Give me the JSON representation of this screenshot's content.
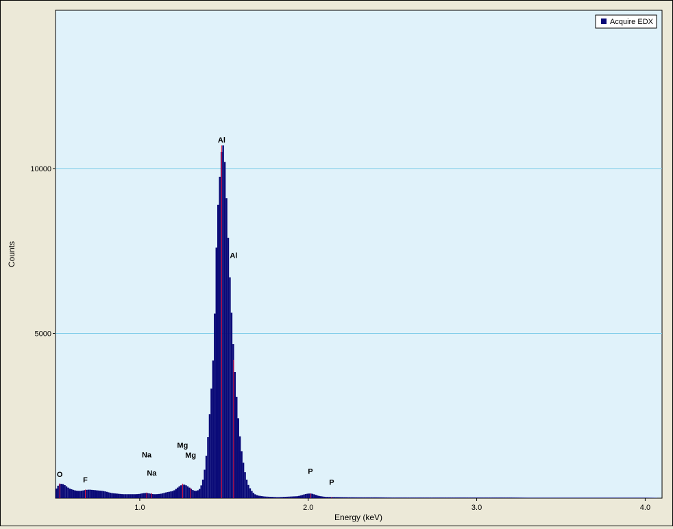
{
  "chart_data": {
    "type": "bar",
    "xlabel": "Energy (keV)",
    "ylabel": "Counts",
    "xlim": [
      0.5,
      4.1
    ],
    "ylim": [
      0,
      14800
    ],
    "x_ticks": [
      {
        "value": 1.0,
        "label": "1.0"
      },
      {
        "value": 2.0,
        "label": "2.0"
      },
      {
        "value": 3.0,
        "label": "3.0"
      },
      {
        "value": 4.0,
        "label": "4.0"
      }
    ],
    "y_ticks": [
      {
        "value": 5000,
        "label": "5000"
      },
      {
        "value": 10000,
        "label": "10000"
      }
    ],
    "grid": "horizontal",
    "legend": {
      "position": "top-right",
      "label": "Acquire EDX"
    },
    "colors": {
      "plot_bg": "#e0f2fa",
      "frame_bg": "#ece9d8",
      "bars": "#0a0a78",
      "gridline": "#7ccbe8",
      "marker": "#e0103c"
    },
    "series": [
      {
        "name": "Acquire EDX",
        "points": [
          [
            0.5,
            250
          ],
          [
            0.52,
            420
          ],
          [
            0.54,
            440
          ],
          [
            0.56,
            380
          ],
          [
            0.58,
            300
          ],
          [
            0.6,
            260
          ],
          [
            0.62,
            230
          ],
          [
            0.64,
            220
          ],
          [
            0.66,
            230
          ],
          [
            0.68,
            250
          ],
          [
            0.7,
            260
          ],
          [
            0.72,
            250
          ],
          [
            0.74,
            240
          ],
          [
            0.76,
            230
          ],
          [
            0.78,
            220
          ],
          [
            0.8,
            200
          ],
          [
            0.82,
            170
          ],
          [
            0.84,
            150
          ],
          [
            0.86,
            140
          ],
          [
            0.88,
            130
          ],
          [
            0.9,
            120
          ],
          [
            0.92,
            120
          ],
          [
            0.94,
            120
          ],
          [
            0.96,
            120
          ],
          [
            0.98,
            120
          ],
          [
            1.0,
            130
          ],
          [
            1.02,
            150
          ],
          [
            1.04,
            160
          ],
          [
            1.06,
            140
          ],
          [
            1.08,
            120
          ],
          [
            1.1,
            120
          ],
          [
            1.12,
            130
          ],
          [
            1.14,
            150
          ],
          [
            1.16,
            180
          ],
          [
            1.18,
            200
          ],
          [
            1.2,
            220
          ],
          [
            1.22,
            300
          ],
          [
            1.24,
            380
          ],
          [
            1.26,
            420
          ],
          [
            1.28,
            380
          ],
          [
            1.3,
            300
          ],
          [
            1.32,
            230
          ],
          [
            1.34,
            220
          ],
          [
            1.36,
            300
          ],
          [
            1.38,
            650
          ],
          [
            1.4,
            1500
          ],
          [
            1.42,
            2900
          ],
          [
            1.44,
            4600
          ],
          [
            1.46,
            8600
          ],
          [
            1.47,
            9200
          ],
          [
            1.48,
            10300
          ],
          [
            1.49,
            10700
          ],
          [
            1.5,
            10700
          ],
          [
            1.51,
            9700
          ],
          [
            1.52,
            8500
          ],
          [
            1.54,
            6100
          ],
          [
            1.56,
            4200
          ],
          [
            1.58,
            2700
          ],
          [
            1.6,
            1600
          ],
          [
            1.62,
            900
          ],
          [
            1.64,
            450
          ],
          [
            1.66,
            250
          ],
          [
            1.68,
            130
          ],
          [
            1.7,
            80
          ],
          [
            1.74,
            50
          ],
          [
            1.78,
            40
          ],
          [
            1.82,
            30
          ],
          [
            1.86,
            40
          ],
          [
            1.9,
            50
          ],
          [
            1.94,
            60
          ],
          [
            1.98,
            120
          ],
          [
            2.0,
            140
          ],
          [
            2.02,
            140
          ],
          [
            2.04,
            110
          ],
          [
            2.06,
            70
          ],
          [
            2.1,
            40
          ],
          [
            2.14,
            35
          ],
          [
            2.2,
            30
          ],
          [
            2.3,
            25
          ],
          [
            2.4,
            25
          ],
          [
            2.5,
            20
          ],
          [
            2.6,
            20
          ],
          [
            2.7,
            20
          ],
          [
            2.8,
            20
          ],
          [
            2.9,
            20
          ],
          [
            3.0,
            20
          ],
          [
            3.1,
            20
          ],
          [
            3.2,
            20
          ],
          [
            3.3,
            15
          ],
          [
            3.4,
            15
          ],
          [
            3.5,
            15
          ],
          [
            3.6,
            15
          ],
          [
            3.7,
            15
          ],
          [
            3.8,
            15
          ],
          [
            3.9,
            15
          ],
          [
            4.0,
            15
          ],
          [
            4.08,
            10
          ]
        ]
      }
    ],
    "peak_labels": [
      {
        "text": "O",
        "x": 0.525,
        "y": 560,
        "marker_y": 450
      },
      {
        "text": "F",
        "x": 0.677,
        "y": 400,
        "marker_y": 260
      },
      {
        "text": "Na",
        "x": 1.041,
        "y": 1150,
        "marker_y": 170
      },
      {
        "text": "Na",
        "x": 1.071,
        "y": 600,
        "marker_y": 150
      },
      {
        "text": "Mg",
        "x": 1.254,
        "y": 1440,
        "marker_y": 440
      },
      {
        "text": "Mg",
        "x": 1.302,
        "y": 1140,
        "marker_y": 300
      },
      {
        "text": "Al",
        "x": 1.486,
        "y": 10700,
        "marker_y": 10700
      },
      {
        "text": "Al",
        "x": 1.557,
        "y": 7200,
        "marker_y": 4200
      },
      {
        "text": "P",
        "x": 2.013,
        "y": 650,
        "marker_y": 140
      },
      {
        "text": "P",
        "x": 2.139,
        "y": 320,
        "marker_y": 30
      }
    ]
  }
}
